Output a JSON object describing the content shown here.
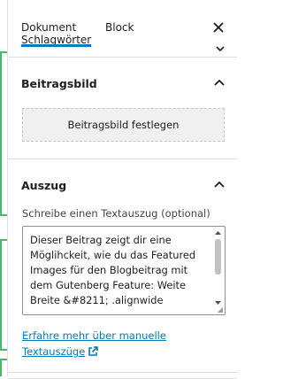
{
  "header": {
    "tab_document": "Dokument",
    "tab_document_sub": "Schlagwörter",
    "tab_block": "Block",
    "close_label": "×"
  },
  "featured_image": {
    "title": "Beitragsbild",
    "button_label": "Beitragsbild festlegen"
  },
  "excerpt": {
    "title": "Auszug",
    "label": "Schreibe einen Textauszug (optional)",
    "value": "Dieser Beitrag zeigt dir eine\nMöglihckeit, wie du das Featured\nImages für den Blogbeitrag mit\ndem Gutenberg Feature: Weite\nBreite &#8211; .alignwide",
    "learn_more_line1": "Erfahre mehr über manuelle",
    "learn_more_line2": "Textauszüge"
  },
  "colors": {
    "accent": "#007cba",
    "green_marker": "#4ab866",
    "border": "#e0e0e0"
  }
}
